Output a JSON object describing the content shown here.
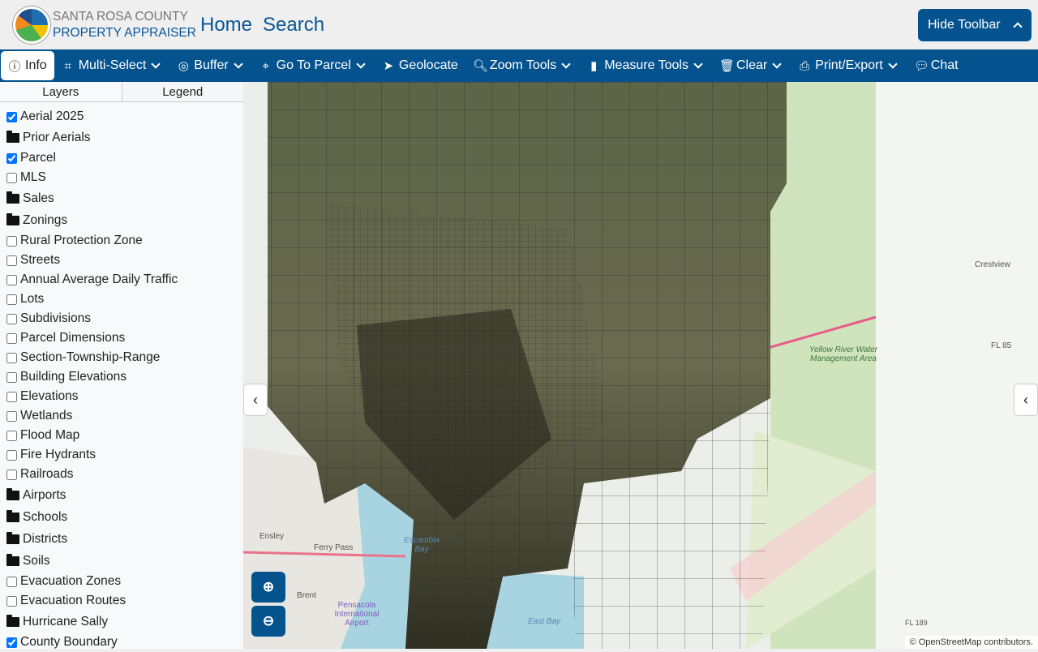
{
  "header": {
    "org_line1": "SANTA ROSA COUNTY",
    "org_line2": "PROPERTY APPRAISER",
    "logo_text": "Santa Rosa County Property Appraiser",
    "nav": [
      "Home",
      "Search"
    ],
    "hide_toolbar": "Hide Toolbar"
  },
  "toolbar": [
    {
      "label": "Info",
      "icon": "info-icon",
      "dropdown": false
    },
    {
      "label": "Multi-Select",
      "icon": "select-icon",
      "dropdown": true
    },
    {
      "label": "Buffer",
      "icon": "life-ring-icon",
      "dropdown": true
    },
    {
      "label": "Go To Parcel",
      "icon": "crosshairs-icon",
      "dropdown": true
    },
    {
      "label": "Geolocate",
      "icon": "location-arrow-icon",
      "dropdown": false
    },
    {
      "label": "Zoom Tools",
      "icon": "zoom-icon",
      "dropdown": true
    },
    {
      "label": "Measure Tools",
      "icon": "ruler-icon",
      "dropdown": true
    },
    {
      "label": "Clear",
      "icon": "trash-icon",
      "dropdown": true
    },
    {
      "label": "Print/Export",
      "icon": "print-icon",
      "dropdown": true
    },
    {
      "label": "Chat",
      "icon": "chat-icon",
      "dropdown": false
    }
  ],
  "sidebar": {
    "tabs": [
      "Layers",
      "Legend"
    ],
    "layers": [
      {
        "label": "Aerial 2025",
        "type": "check",
        "checked": true
      },
      {
        "label": "Prior Aerials",
        "type": "folder"
      },
      {
        "label": "Parcel",
        "type": "check",
        "checked": true
      },
      {
        "label": "MLS",
        "type": "check",
        "checked": false
      },
      {
        "label": "Sales",
        "type": "folder"
      },
      {
        "label": "Zonings",
        "type": "folder"
      },
      {
        "label": "Rural Protection Zone",
        "type": "check",
        "checked": false
      },
      {
        "label": "Streets",
        "type": "check",
        "checked": false
      },
      {
        "label": "Annual Average Daily Traffic",
        "type": "check",
        "checked": false
      },
      {
        "label": "Lots",
        "type": "check",
        "checked": false
      },
      {
        "label": "Subdivisions",
        "type": "check",
        "checked": false
      },
      {
        "label": "Parcel Dimensions",
        "type": "check",
        "checked": false
      },
      {
        "label": "Section-Township-Range",
        "type": "check",
        "checked": false
      },
      {
        "label": "Building Elevations",
        "type": "check",
        "checked": false
      },
      {
        "label": "Elevations",
        "type": "check",
        "checked": false
      },
      {
        "label": "Wetlands",
        "type": "check",
        "checked": false
      },
      {
        "label": "Flood Map",
        "type": "check",
        "checked": false
      },
      {
        "label": "Fire Hydrants",
        "type": "check",
        "checked": false
      },
      {
        "label": "Railroads",
        "type": "check",
        "checked": false
      },
      {
        "label": "Airports",
        "type": "folder"
      },
      {
        "label": "Schools",
        "type": "folder"
      },
      {
        "label": "Districts",
        "type": "folder"
      },
      {
        "label": "Soils",
        "type": "folder"
      },
      {
        "label": "Evacuation Zones",
        "type": "check",
        "checked": false
      },
      {
        "label": "Evacuation Routes",
        "type": "check",
        "checked": false
      },
      {
        "label": "Hurricane Sally",
        "type": "folder"
      },
      {
        "label": "County Boundary",
        "type": "check",
        "checked": true
      }
    ]
  },
  "map": {
    "labels": [
      "Crestview",
      "Yellow River Water Management Area",
      "FL 85",
      "Ensley",
      "Ferry Pass",
      "Escambia Bay",
      "Brent",
      "Pensacola International Airport",
      "East Bay",
      "FL 189"
    ],
    "attribution": "© OpenStreetMap contributors."
  }
}
